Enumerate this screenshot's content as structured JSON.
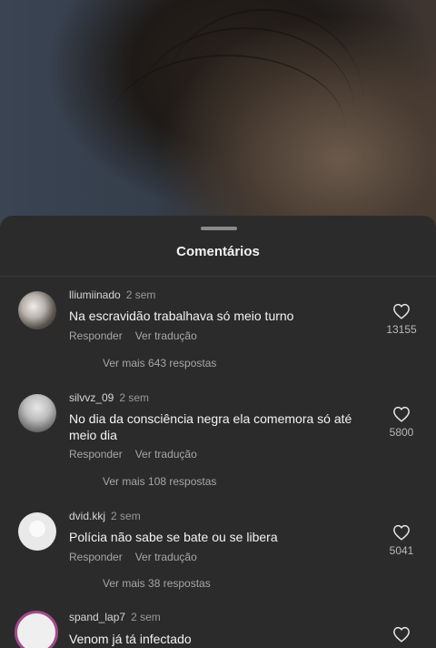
{
  "sheet": {
    "title": "Comentários"
  },
  "comments": [
    {
      "username": "lliumiinado",
      "time": "2 sem",
      "text": "Na escravidão trabalhava só meio turno",
      "reply_label": "Responder",
      "translate_label": "Ver tradução",
      "likes": "13155",
      "more_replies": "Ver mais 643 respostas",
      "avatar": "photo-avatar"
    },
    {
      "username": "silvvz_09",
      "time": "2 sem",
      "text": "No dia da consciência negra ela comemora só até meio dia",
      "reply_label": "Responder",
      "translate_label": "Ver tradução",
      "likes": "5800",
      "more_replies": "Ver mais 108 respostas",
      "avatar": "photo-avatar"
    },
    {
      "username": "dvid.kkj",
      "time": "2 sem",
      "text": "Polícia não sabe se bate ou se libera",
      "reply_label": "Responder",
      "translate_label": "Ver tradução",
      "likes": "5041",
      "more_replies": "Ver mais 38 respostas",
      "avatar": "placeholder-avatar"
    },
    {
      "username": "spand_lap7",
      "time": "2 sem",
      "text": "Venom já tá infectado",
      "avatar": "story-ring-avatar"
    }
  ],
  "icons": {
    "like": "heart-outline-icon"
  },
  "colors": {
    "sheet_bg": "#2b2b2b",
    "story_ring": "#a24b8a"
  }
}
